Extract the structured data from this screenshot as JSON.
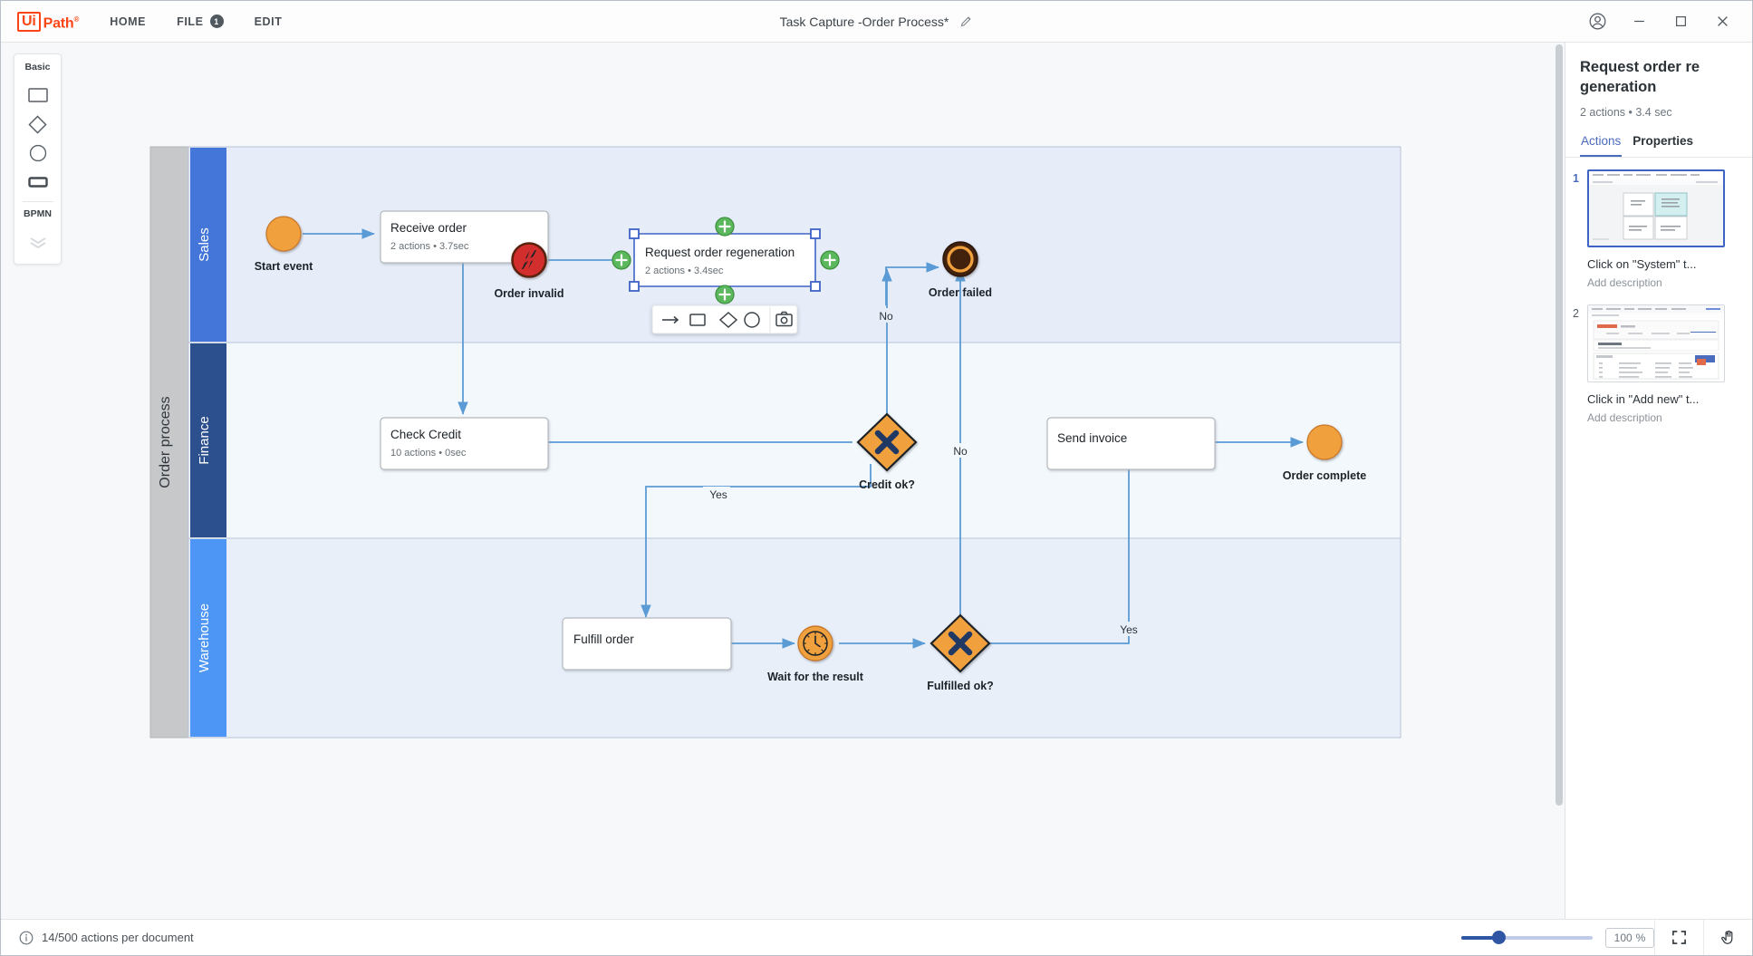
{
  "window": {
    "brand_ui": "Ui",
    "brand_path": "Path",
    "document_title": "Task Capture -Order Process*",
    "edit_title_icon": "pencil-icon",
    "account_icon": "account-circle-icon",
    "minimize_icon": "minimize-icon",
    "maximize_icon": "maximize-icon",
    "close_icon": "close-icon"
  },
  "menu": {
    "items": [
      {
        "label": "HOME",
        "badge": null
      },
      {
        "label": "FILE",
        "badge": "1"
      },
      {
        "label": "EDIT",
        "badge": null
      }
    ]
  },
  "palette": {
    "basic_label": "Basic",
    "bpmn_label": "BPMN",
    "basic_shapes": [
      "rectangle-shape",
      "diamond-shape",
      "circle-shape",
      "rounded-rect-shape"
    ],
    "bpmn_toggle": "chevron-down-icon"
  },
  "node_toolbar": {
    "items": [
      "arrow-tool",
      "rectangle-tool",
      "diamond-tool",
      "circle-tool",
      "screenshot-tool"
    ]
  },
  "right_panel": {
    "title": "Request order re generation",
    "subtitle": "2 actions • 3.4 sec",
    "tabs": [
      {
        "label": "Actions",
        "active": true
      },
      {
        "label": "Properties",
        "active": false
      }
    ],
    "actions": [
      {
        "number": "1",
        "caption": "Click on \"System\" t...",
        "description": "Add description",
        "selected": true
      },
      {
        "number": "2",
        "caption": "Click in \"Add new\" t...",
        "description": "Add description",
        "selected": false
      }
    ]
  },
  "statusbar": {
    "info_icon": "info-circle-icon",
    "actions_text": "14/500 actions per document",
    "zoom_value": "100",
    "zoom_unit": "%",
    "fit_icon": "fit-screen-icon",
    "pan_icon": "hand-pan-icon"
  },
  "diagram": {
    "pool_label": "Order process",
    "lanes": [
      {
        "label": "Sales",
        "color": "#4376d8"
      },
      {
        "label": "Finance",
        "color": "#2c4f8e"
      },
      {
        "label": "Warehouse",
        "color": "#4d96f5"
      }
    ],
    "nodes": [
      {
        "id": "start",
        "type": "start-event",
        "label": "Start event"
      },
      {
        "id": "receive",
        "type": "task",
        "label": "Receive order",
        "meta": "2 actions  •  3.7sec"
      },
      {
        "id": "invalid",
        "type": "error-event",
        "label": "Order invalid"
      },
      {
        "id": "regen",
        "type": "task-selected",
        "label": "Request order regeneration",
        "meta": "2 actions  •  3.4sec"
      },
      {
        "id": "failed",
        "type": "end-event",
        "label": "Order failed"
      },
      {
        "id": "check",
        "type": "task",
        "label": "Check Credit",
        "meta": "10 actions  •  0sec"
      },
      {
        "id": "creditok",
        "type": "gateway",
        "label": "Credit ok?"
      },
      {
        "id": "invoice",
        "type": "task",
        "label": "Send invoice"
      },
      {
        "id": "complete",
        "type": "end-event-open",
        "label": "Order complete"
      },
      {
        "id": "fulfill",
        "type": "task",
        "label": "Fulfill order"
      },
      {
        "id": "wait",
        "type": "timer-event",
        "label": "Wait for the result"
      },
      {
        "id": "fulfilled",
        "type": "gateway",
        "label": "Fulfilled ok?"
      }
    ],
    "edge_labels": [
      {
        "id": "no1",
        "text": "No"
      },
      {
        "id": "no2",
        "text": "No"
      },
      {
        "id": "yes1",
        "text": "Yes"
      },
      {
        "id": "yes2",
        "text": "Yes"
      }
    ],
    "colors": {
      "lane_body_sales": "#e6ecf8",
      "lane_body_finance": "#f2f8fc",
      "lane_body_warehouse": "#e8eff9",
      "pool_header": "#c6c8ca",
      "connector": "#5b9bd5",
      "event_orange": "#f0a03c",
      "gateway_orange": "#f0a03c",
      "error_red": "#d32f2f",
      "end_brown": "#42210b"
    }
  }
}
